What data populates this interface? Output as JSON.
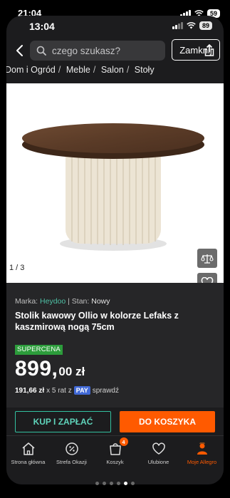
{
  "outer_status": {
    "time": "21:04",
    "battery": "59"
  },
  "inner_status": {
    "time": "13:04",
    "battery": "89"
  },
  "header": {
    "search_placeholder": "czego szukasz?",
    "close_label": "Zamknij"
  },
  "breadcrumbs": [
    "Dom i Ogród",
    "Meble",
    "Salon",
    "Stoły"
  ],
  "gallery": {
    "counter": "1 / 3"
  },
  "product": {
    "brand_prefix": "Marka:",
    "brand": "Heydoo",
    "condition_prefix": "| Stan:",
    "condition": "Nowy",
    "title": "Stolik kawowy Ollio w kolorze Lefaks z kaszmirową nogą 75cm",
    "badge": "SUPERCENA",
    "price_main": "899,",
    "price_frac": "00 zł",
    "installment_amount": "191,66 zł",
    "installment_text": "x 5 rat z",
    "pay_label": "PAY",
    "installment_suffix": "sprawdź"
  },
  "actions": {
    "buy_now": "KUP I ZAPŁAĆ",
    "add_to_cart": "DO KOSZYKA"
  },
  "tabbar": {
    "items": [
      {
        "label": "Strona główna",
        "icon": "home-icon"
      },
      {
        "label": "Strefa Okazji",
        "icon": "deal-icon"
      },
      {
        "label": "Koszyk",
        "icon": "cart-icon",
        "badge": "4"
      },
      {
        "label": "Ulubione",
        "icon": "heart-icon"
      },
      {
        "label": "Moje Allegro",
        "icon": "person-icon",
        "active": true
      }
    ]
  },
  "colors": {
    "accent": "#ff5a00",
    "teal": "#33c0a0",
    "background": "#1c1c1e"
  }
}
